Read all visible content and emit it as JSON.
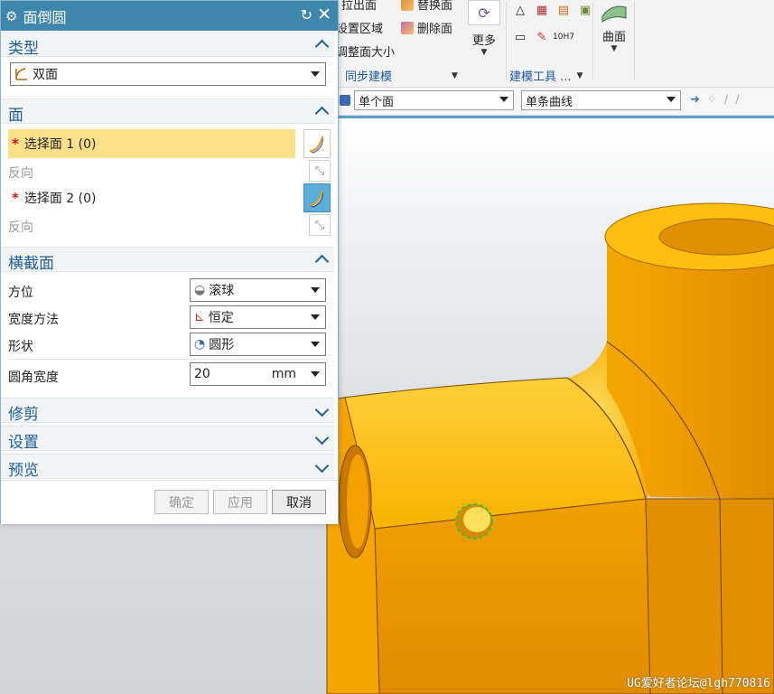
{
  "dialog": {
    "title": "面倒圆",
    "sections": {
      "type": {
        "label": "类型",
        "value": "双面"
      },
      "face": {
        "label": "面",
        "select1": "选择面 1 (0)",
        "reverse1": "反向",
        "select2": "选择面 2 (0)",
        "reverse2": "反向"
      },
      "cross_section": {
        "label": "横截面",
        "orientation": {
          "label": "方位",
          "value": "滚球"
        },
        "width_method": {
          "label": "宽度方法",
          "value": "恒定"
        },
        "shape": {
          "label": "形状",
          "value": "圆形"
        },
        "blend_width": {
          "label": "圆角宽度",
          "value": "20",
          "unit": "mm"
        }
      },
      "trim": {
        "label": "修剪"
      },
      "settings": {
        "label": "设置"
      },
      "preview": {
        "label": "预览"
      }
    },
    "buttons": {
      "ok": "确定",
      "apply": "应用",
      "cancel": "取消"
    }
  },
  "ribbon": {
    "items": {
      "item_a": "拉出面",
      "item_b": "替换面",
      "item_c": "设置区域",
      "item_d": "删除面",
      "item_e": "调整面大小",
      "more": "更多",
      "surface": "曲面"
    },
    "groups": {
      "sync": "同步建模",
      "modeling_tools": "建模工具 ..."
    }
  },
  "selection_bar": {
    "face_filter": "单个面",
    "curve_rule": "单条曲线"
  },
  "watermark": "UG爱好者论坛@lgh770816",
  "colors": {
    "title_bar": "#3f86ad",
    "active_row": "#fde08a",
    "part_orange": "#f5a300",
    "section_text": "#1d5f9a"
  }
}
